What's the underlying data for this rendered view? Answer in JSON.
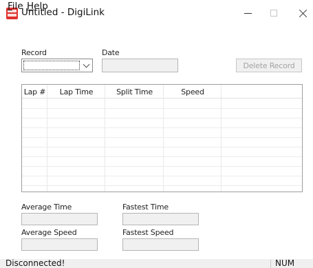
{
  "window": {
    "title": "Untitled - DigiLink",
    "icon": "digilink-app-icon"
  },
  "menu": {
    "items": [
      {
        "label": "File"
      },
      {
        "label": "Help"
      }
    ]
  },
  "record": {
    "label": "Record",
    "value": ""
  },
  "date": {
    "label": "Date",
    "value": ""
  },
  "delete_button": {
    "label": "Delete Record",
    "enabled": false
  },
  "laps_table": {
    "columns": [
      "Lap #",
      "Lap Time",
      "Split Time",
      "Speed",
      ""
    ],
    "rows": []
  },
  "stats": {
    "average_time": {
      "label": "Average Time",
      "value": ""
    },
    "fastest_time": {
      "label": "Fastest Time",
      "value": ""
    },
    "average_speed": {
      "label": "Average Speed",
      "value": ""
    },
    "fastest_speed": {
      "label": "Fastest Speed",
      "value": ""
    }
  },
  "status": {
    "message": "Disconnected!",
    "num_indicator": "NUM"
  },
  "colors": {
    "app_icon": "#e0312c",
    "disabled_text": "#a3a3a3",
    "field_background": "#f0f0f0"
  }
}
